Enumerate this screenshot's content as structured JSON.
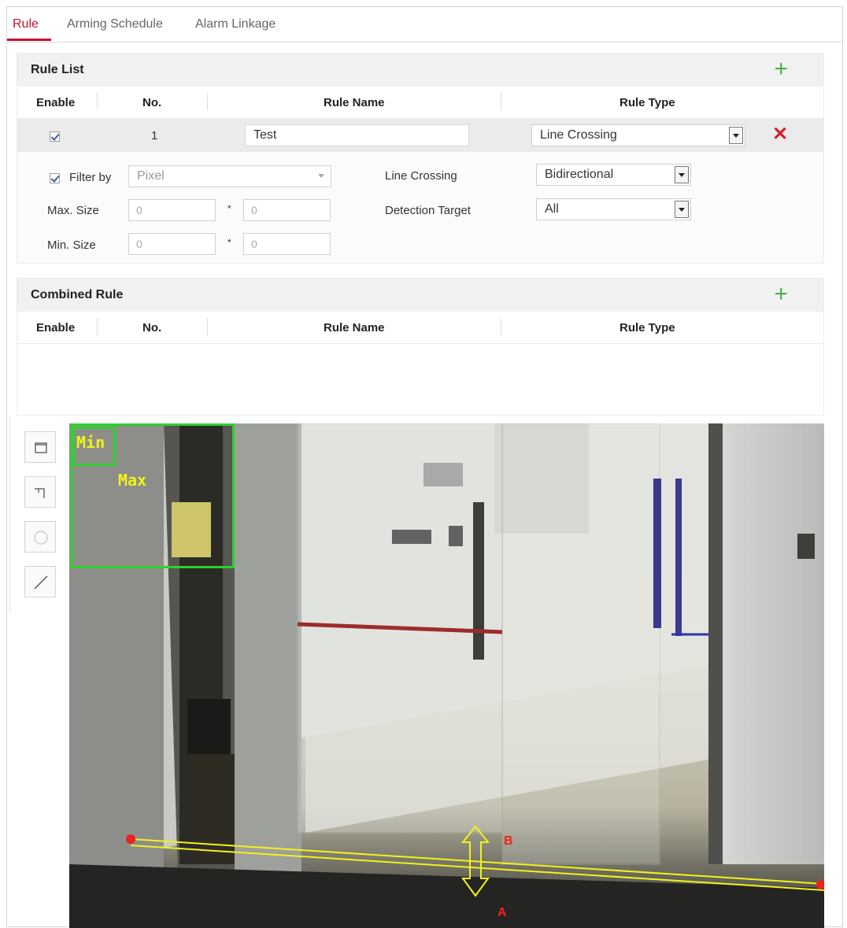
{
  "tabs": [
    {
      "label": "Rule"
    },
    {
      "label": "Arming Schedule"
    },
    {
      "label": "Alarm Linkage"
    }
  ],
  "rule_list": {
    "title": "Rule List",
    "columns": {
      "enable": "Enable",
      "no": "No.",
      "rule_name": "Rule Name",
      "rule_type": "Rule Type"
    },
    "rows": [
      {
        "enabled": true,
        "no": "1",
        "name": "Test",
        "type": "Line Crossing"
      }
    ],
    "details": {
      "filter_by_label": "Filter by",
      "filter_by_value": "Pixel",
      "max_size_label": "Max. Size",
      "min_size_label": "Min. Size",
      "max_w": "0",
      "max_h": "0",
      "min_w": "0",
      "min_h": "0",
      "star": "*",
      "line_crossing_label": "Line Crossing",
      "line_crossing_value": "Bidirectional",
      "detection_target_label": "Detection Target",
      "detection_target_value": "All"
    }
  },
  "combined_rule": {
    "title": "Combined Rule",
    "columns": {
      "enable": "Enable",
      "no": "No.",
      "rule_name": "Rule Name",
      "rule_type": "Rule Type"
    }
  },
  "overlay": {
    "min_label": "Min",
    "max_label": "Max",
    "point_b": "B",
    "point_a": "A"
  },
  "tools": [
    {
      "icon": "rectangle-icon"
    },
    {
      "icon": "rectangle-corner-icon"
    },
    {
      "icon": "circle-icon"
    },
    {
      "icon": "line-icon"
    }
  ],
  "colors": {
    "accent": "#c8102e",
    "add": "#4cae4c",
    "delete": "#d21f2b",
    "min_max_box": "#2ed12e",
    "line": "#f2f21a"
  }
}
